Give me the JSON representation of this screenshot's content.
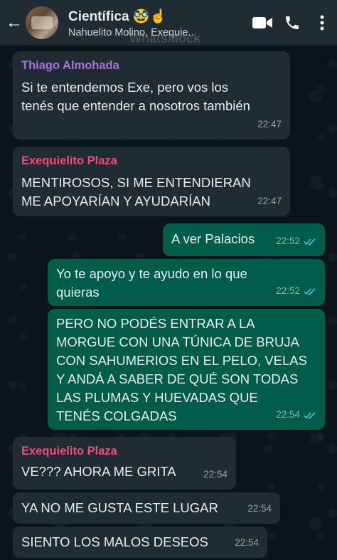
{
  "header": {
    "back_label": "←",
    "title": "Científica 🥸☝",
    "subtitle": "Nahuelito Molino, Exequie..",
    "video_icon": "video-call-icon",
    "call_icon": "phone-icon",
    "menu_icon": "more-options-icon"
  },
  "watermark": "WhatsMock",
  "colors": {
    "header_bg": "#1f2c34",
    "incoming_bubble": "#1f2c34",
    "outgoing_bubble": "#005c4b",
    "sender_thiago": "#a774d6",
    "sender_exequielito": "#ec4d7c",
    "read_ticks": "#53bdeb"
  },
  "messages": [
    {
      "sender": "Thiago Almohada",
      "text_lines": [
        "Si te entendemos Exe, pero vos los",
        "tenés que entender a nosotros también"
      ],
      "time": "22:47"
    },
    {
      "sender": "Exequielito Plaza",
      "text_lines": [
        "MENTIROSOS, SI ME ENTENDIERAN",
        "ME APOYARÍAN Y AYUDARÍAN"
      ],
      "time": "22:47"
    },
    {
      "sender": "",
      "text_lines": [
        "A ver Palacios"
      ],
      "time": "22:52"
    },
    {
      "sender": "",
      "text_lines": [
        "Yo te apoyo y te ayudo en lo que",
        "quieras"
      ],
      "time": "22:52"
    },
    {
      "sender": "",
      "text_lines": [
        "PERO NO PODÉS ENTRAR A LA",
        "MORGUE CON UNA TÚNICA DE BRUJA",
        "CON SAHUMERIOS EN EL PELO, VELAS",
        "Y ANDÁ A SABER DE QUÉ SON TODAS",
        "LAS PLUMAS Y HUEVADAS QUE",
        "TENÉS COLGADAS"
      ],
      "time": "22:54"
    },
    {
      "sender": "Exequielito Plaza",
      "text_lines": [
        "VE??? AHORA ME GRITA"
      ],
      "time": "22:54"
    },
    {
      "sender": "",
      "text_lines": [
        "YA NO ME GUSTA ESTE LUGAR"
      ],
      "time": "22:54"
    },
    {
      "sender": "",
      "text_lines": [
        "SIENTO LOS MALOS DESEOS"
      ],
      "time": "22:54"
    }
  ]
}
